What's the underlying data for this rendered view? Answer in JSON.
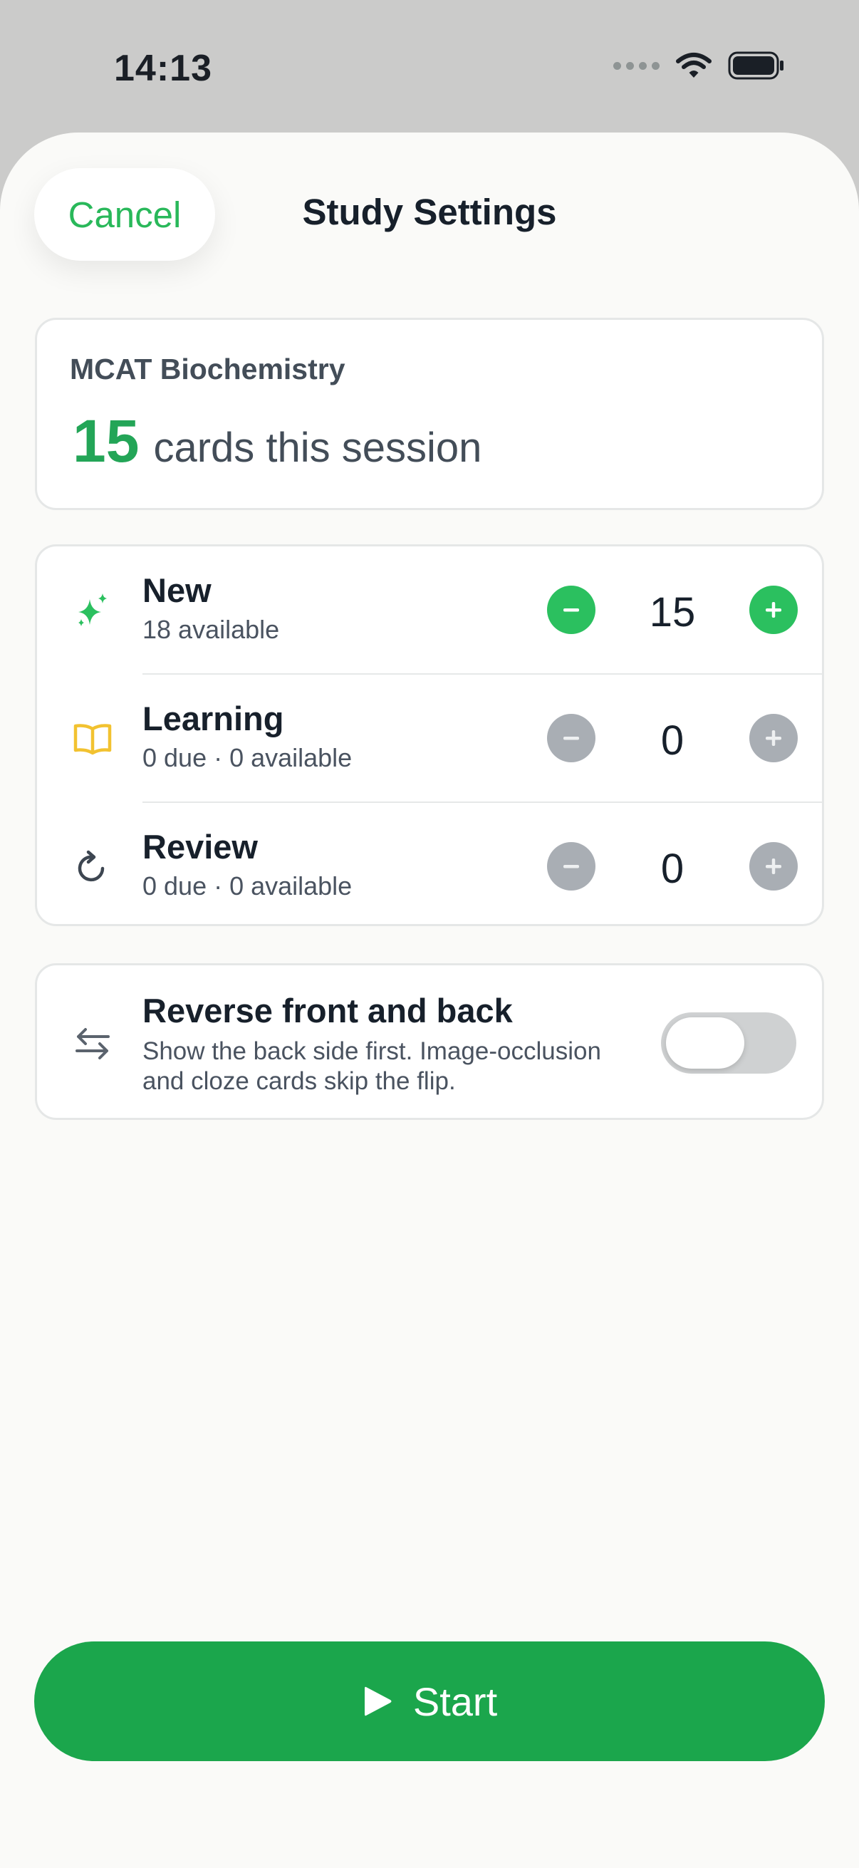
{
  "status_bar": {
    "time": "14:13"
  },
  "header": {
    "cancel_label": "Cancel",
    "title": "Study Settings"
  },
  "summary": {
    "deck_name": "MCAT Biochemistry",
    "count": "15",
    "count_suffix": "cards this session"
  },
  "counts": {
    "rows": [
      {
        "label": "New",
        "sub": "18 available",
        "value": "15",
        "icon": "sparkles-icon",
        "active": true
      },
      {
        "label": "Learning",
        "sub": "0 due · 0 available",
        "value": "0",
        "icon": "open-book-icon",
        "active": false
      },
      {
        "label": "Review",
        "sub": "0 due · 0 available",
        "value": "0",
        "icon": "refresh-icon",
        "active": false
      }
    ]
  },
  "reverse": {
    "label": "Reverse front and back",
    "description": "Show the back side first. Image-occlusion and cloze cards skip the flip.",
    "enabled": false,
    "icon": "swap-arrows-icon"
  },
  "start": {
    "label": "Start",
    "icon": "play-icon"
  },
  "colors": {
    "accent_green": "#2bc05f",
    "start_green": "#1ba64c",
    "count_green": "#23a557",
    "learning_yellow": "#f2c230",
    "disabled_gray": "#a9aeb4"
  }
}
